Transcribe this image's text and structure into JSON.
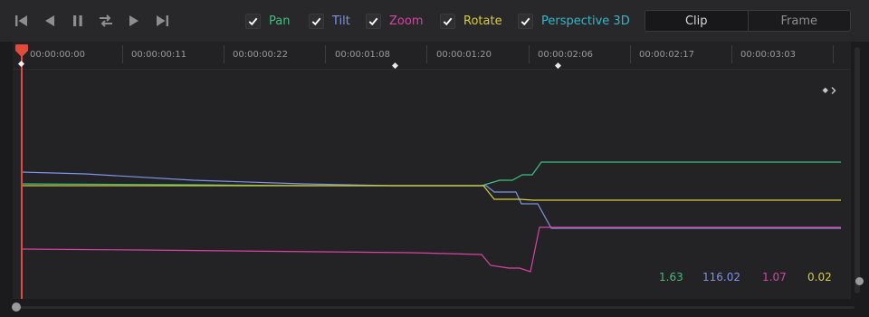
{
  "toolbar": {
    "transport": [
      "skip-to-start-icon",
      "step-back-icon",
      "pause-icon",
      "loop-icon",
      "play-icon",
      "skip-to-end-icon"
    ],
    "checkboxes": [
      {
        "label": "Pan",
        "checked": true,
        "color": "#3fbf7f"
      },
      {
        "label": "Tilt",
        "checked": true,
        "color": "#7f93e8"
      },
      {
        "label": "Zoom",
        "checked": true,
        "color": "#d843a4"
      },
      {
        "label": "Rotate",
        "checked": true,
        "color": "#d8cc3a"
      },
      {
        "label": "Perspective 3D",
        "checked": true,
        "color": "#2fb8cc"
      }
    ],
    "mode": {
      "options": [
        "Clip",
        "Frame"
      ],
      "selected": "Clip"
    }
  },
  "timeline": {
    "timecodes": [
      "00:00:00:00",
      "00:00:00:11",
      "00:00:00:22",
      "00:00:01:08",
      "00:00:01:20",
      "00:00:02:06",
      "00:00:02:17",
      "00:00:03:03"
    ],
    "playhead": "00:00:00:00"
  },
  "values": {
    "pan": "1.63",
    "tilt": "116.02",
    "zoom": "1.07",
    "rotate": "0.02"
  },
  "colors": {
    "pan": "#3fbf7f",
    "tilt": "#7f93e8",
    "zoom": "#d843a4",
    "rotate": "#d8cc3a",
    "playhead": "#e24b3b"
  }
}
